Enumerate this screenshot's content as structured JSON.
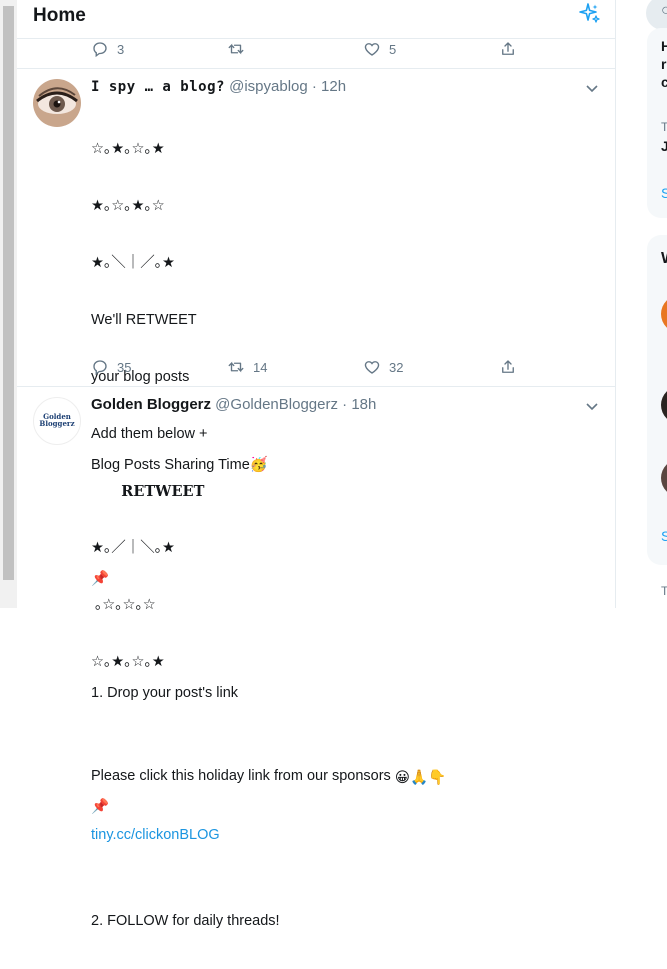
{
  "header": {
    "title": "Home"
  },
  "prev_tweet": {
    "reply_count": "3",
    "retweet_count": "",
    "like_count": "5"
  },
  "tweets": [
    {
      "name": "I spy … a blog?",
      "handle": "@ispyablog",
      "time": "· 12h",
      "lines": [
        "☆｡★｡☆｡★",
        "★｡☆｡★｡☆",
        "★｡＼｜／｡★",
        "We'll RETWEET",
        "your blog posts",
        "Add them below +",
        "      RETWEET",
        "★｡／｜＼｡★",
        " ｡☆｡☆｡☆",
        "☆｡★｡☆｡★",
        "",
        "Please click this holiday link from our sponsors"
      ],
      "emojis": "😀🙏👇",
      "link": "tiny.cc/clickonBLOG",
      "reply_count": "35",
      "retweet_count": "14",
      "like_count": "32"
    },
    {
      "name": "Golden Bloggerz",
      "handle": "@GoldenBloggerz",
      "time": "· 18h",
      "avatar_text": "Golden Bloggerz",
      "lines": [
        "Blog Posts Sharing Time🥳",
        "",
        "📌",
        "",
        "1. Drop your post's link",
        "",
        "📌",
        "",
        "2. FOLLOW for daily threads!"
      ]
    }
  ],
  "right_column": {
    "fragments": [
      "H",
      "r",
      "c",
      "T",
      "J",
      "S",
      "W",
      "S",
      "T"
    ]
  },
  "colors": {
    "accent": "#1da1f2",
    "link": "#1b95e0",
    "muted": "#657786",
    "border": "#e6ecf0"
  }
}
